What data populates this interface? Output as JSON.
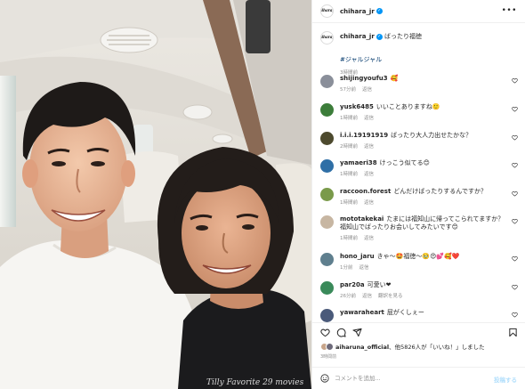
{
  "header": {
    "avatar_text": "chihara_jr",
    "username": "chihara_jr",
    "more_icon": "more-horizontal-icon"
  },
  "caption": {
    "username": "chihara_jr",
    "text": "ばったり福徳",
    "hashtag": "#ジャルジャル",
    "time": "3時間前"
  },
  "comments": [
    {
      "user": "shijingyoufu3",
      "text": "🥰",
      "time": "57分前",
      "reply": "返信",
      "extra": "",
      "color": "#8a8f9a"
    },
    {
      "user": "yusk6485",
      "text": "いいことありますね🙂",
      "time": "1時間前",
      "reply": "返信",
      "extra": "",
      "color": "#3c7d3a"
    },
    {
      "user": "i.i.i.19191919",
      "text": "ばったり大人力出せたかな？",
      "time": "2時間前",
      "reply": "返信",
      "extra": "",
      "color": "#4d4a2e"
    },
    {
      "user": "yamaeri38",
      "text": "けっこう似てる😊",
      "time": "1時間前",
      "reply": "返信",
      "extra": "",
      "color": "#2f6fa6"
    },
    {
      "user": "raccoon.forest",
      "text": "どんだけばったりするんですか？",
      "time": "1時間前",
      "reply": "返信",
      "extra": "",
      "color": "#7a9a4a"
    },
    {
      "user": "mototakekai",
      "text": "たまには福知山に帰ってこられてますか？福知山でばったりお会いしてみたいです😊",
      "time": "1時間前",
      "reply": "返信",
      "extra": "",
      "color": "#c7b6a2"
    },
    {
      "user": "hono_jaru",
      "text": "きゃ〜🤩福徳〜🥹😍💕🥰❤️",
      "time": "1分前",
      "reply": "返信",
      "extra": "",
      "color": "#5f7f8e"
    },
    {
      "user": "par20a",
      "text": "可愛い❤",
      "time": "26分前",
      "reply": "返信",
      "extra": "翻訳を見る",
      "color": "#3a8a5a"
    },
    {
      "user": "yawaraheart",
      "text": "屁がくしぇー",
      "time": "",
      "reply": "",
      "extra": "",
      "color": "#4a5a7a"
    }
  ],
  "actions": {
    "like_icon": "heart-icon",
    "comment_icon": "comment-icon",
    "share_icon": "paper-plane-icon",
    "save_icon": "bookmark-icon"
  },
  "likes": {
    "user": "aiharuna_official",
    "middle": "、他5826人が「いいね！」しました"
  },
  "post_time": "3時間前",
  "add_comment": {
    "placeholder": "コメントを追加...",
    "post_label": "投稿する"
  },
  "colors": {
    "link": "#00376b",
    "meta": "#8e8e8e",
    "verified": "#0095f6",
    "post_disabled": "#b2dffc"
  }
}
